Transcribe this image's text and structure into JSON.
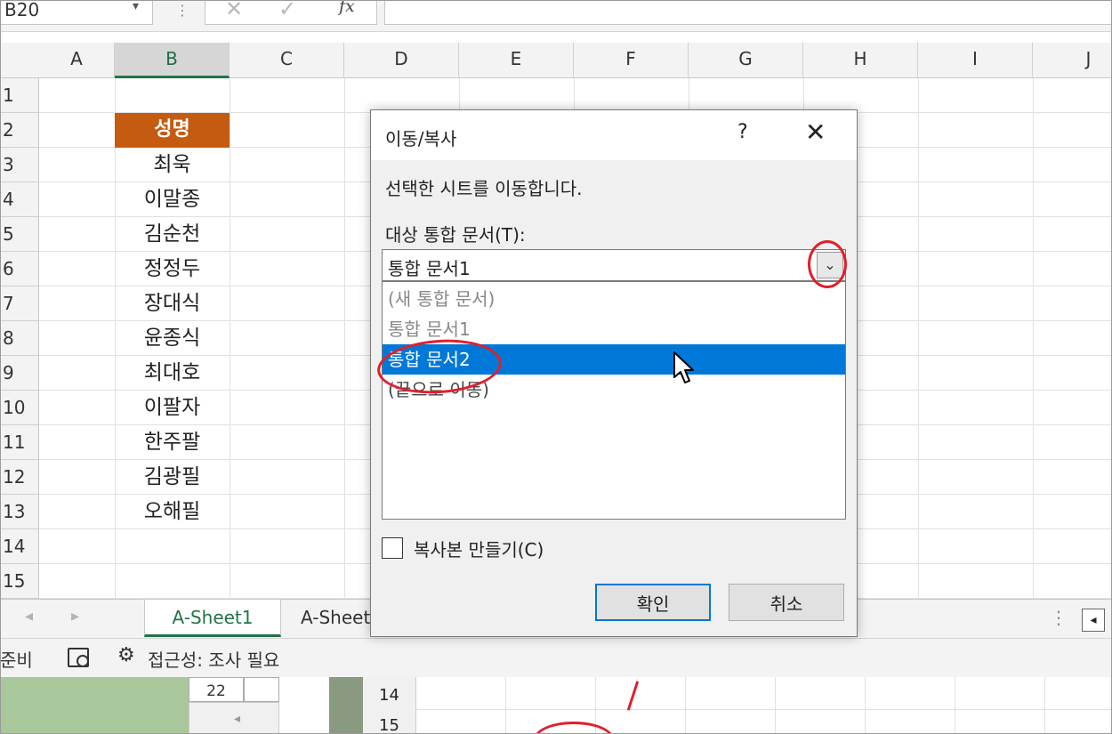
{
  "formula_bar": {
    "name_box": "B20",
    "fx_label": "fx"
  },
  "columns": [
    "A",
    "B",
    "C",
    "D",
    "E",
    "F",
    "G",
    "H",
    "I",
    "J"
  ],
  "rows": [
    "1",
    "2",
    "3",
    "4",
    "5",
    "6",
    "7",
    "8",
    "9",
    "10",
    "11",
    "12",
    "13",
    "14",
    "15"
  ],
  "cells": {
    "header": "성명",
    "names": [
      "최욱",
      "이말종",
      "김순천",
      "정정두",
      "장대식",
      "윤종식",
      "최대호",
      "이팔자",
      "한주팔",
      "김광필",
      "오해필"
    ]
  },
  "sheet_tabs": {
    "active": "A-Sheet1",
    "next": "A-Sheet"
  },
  "status": {
    "ready": "준비",
    "accessibility": "접근성: 조사 필요"
  },
  "background_window": {
    "cell_value": "22",
    "row_a": "14",
    "row_b": "15"
  },
  "dialog": {
    "title": "이동/복사",
    "help": "?",
    "close": "✕",
    "description": "선택한 시트를 이동합니다.",
    "target_label": "대상 통합 문서(T):",
    "target_value": "통합 문서1",
    "list_items": [
      "(새 통합 문서)",
      "통합 문서1",
      "통합 문서2",
      "(끝으로 이동)"
    ],
    "selected_item": "통합 문서2",
    "copy_checkbox_label": "복사본 만들기(C)",
    "copy_checked": false,
    "ok_label": "확인",
    "cancel_label": "취소"
  },
  "colors": {
    "header_fill": "#c55a11",
    "excel_green": "#217346",
    "selection_blue": "#0078d7",
    "annotation_red": "#e0202a"
  }
}
